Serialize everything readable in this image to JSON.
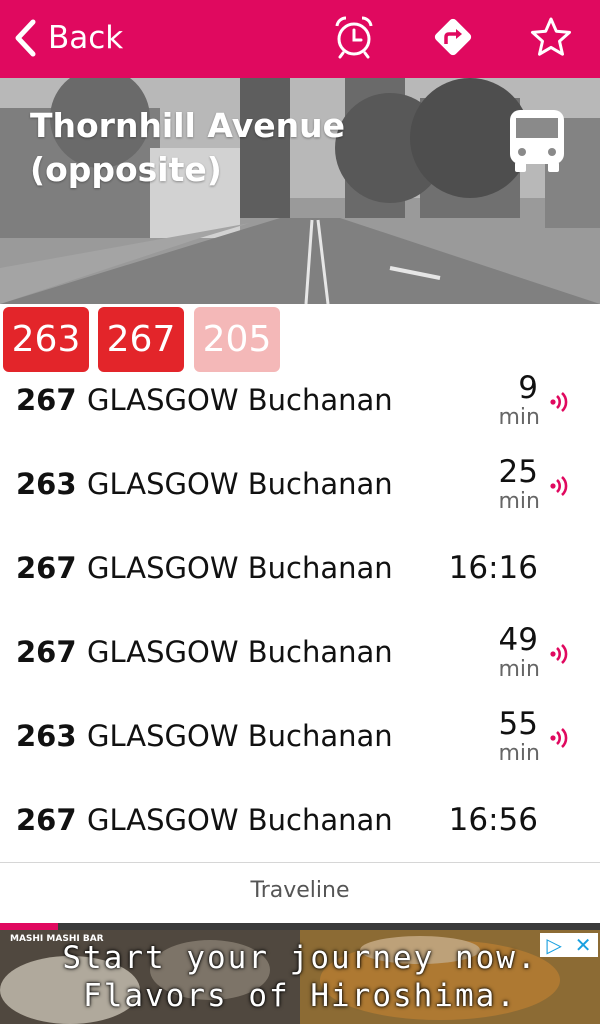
{
  "nav": {
    "back_label": "Back",
    "icons": [
      "alarm-clock-icon",
      "directions-icon",
      "star-icon"
    ],
    "color": "#e0095f"
  },
  "stop": {
    "name": "Thornhill Avenue (opposite)",
    "name_line1": "Thornhill Avenue",
    "name_line2": "(opposite)",
    "icon": "bus-icon"
  },
  "routes": [
    {
      "label": "263",
      "state": "active"
    },
    {
      "label": "267",
      "state": "active"
    },
    {
      "label": "205",
      "state": "inactive"
    }
  ],
  "departures": [
    {
      "route": "267",
      "destination": "GLASGOW Buchanan",
      "due": "9",
      "unit": "min",
      "realtime": true
    },
    {
      "route": "263",
      "destination": "GLASGOW Buchanan",
      "due": "25",
      "unit": "min",
      "realtime": true
    },
    {
      "route": "267",
      "destination": "GLASGOW Buchanan",
      "time": "16:16",
      "realtime": false
    },
    {
      "route": "267",
      "destination": "GLASGOW Buchanan",
      "due": "49",
      "unit": "min",
      "realtime": true
    },
    {
      "route": "263",
      "destination": "GLASGOW Buchanan",
      "due": "55",
      "unit": "min",
      "realtime": true
    },
    {
      "route": "267",
      "destination": "GLASGOW Buchanan",
      "time": "16:56",
      "realtime": false
    }
  ],
  "source": "Traveline",
  "ad": {
    "line1": "Start your journey now.",
    "line2": "Flavors of Hiroshima.",
    "brand": "MASHI MASHI BAR"
  },
  "colors": {
    "accent": "#e0095f",
    "route_active": "#e3252a",
    "route_inactive": "#f4b8b8"
  }
}
